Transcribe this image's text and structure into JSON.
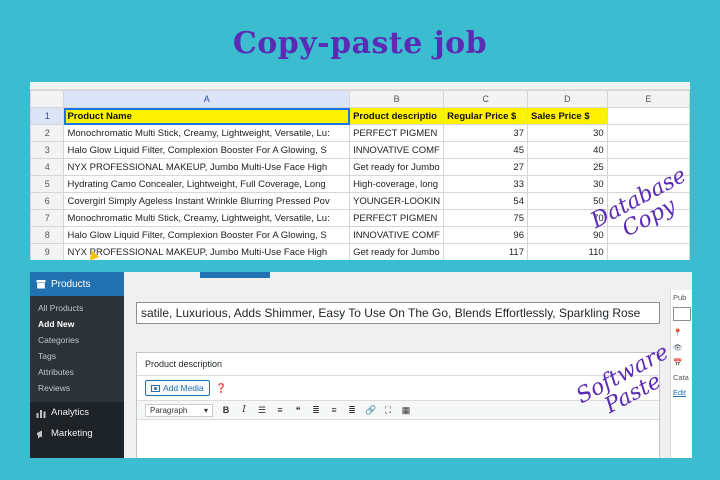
{
  "title": "Copy-paste job",
  "sheet": {
    "columns": [
      "A",
      "B",
      "C",
      "D",
      "E"
    ],
    "row_numbers": [
      "1",
      "2",
      "3",
      "4",
      "5",
      "6",
      "7",
      "8",
      "9"
    ],
    "headers": [
      "Product Name",
      "Product descriptio",
      "Regular Price $",
      "Sales Price $"
    ],
    "rows": [
      [
        "Monochromatic Multi Stick, Creamy, Lightweight, Versatile, Lu:",
        "PERFECT PIGMEN",
        "37",
        "30"
      ],
      [
        "Halo Glow Liquid Filter, Complexion Booster For A Glowing, S",
        "INNOVATIVE COMF",
        "45",
        "40"
      ],
      [
        "NYX PROFESSIONAL MAKEUP, Jumbo Multi-Use Face High",
        "Get ready for Jumbo",
        "27",
        "25"
      ],
      [
        "Hydrating Camo Concealer, Lightweight, Full Coverage, Long",
        "High-coverage, long",
        "33",
        "30"
      ],
      [
        "Covergirl Simply Ageless Instant Wrinkle Blurring Pressed Pov",
        "YOUNGER-LOOKIN",
        "54",
        "50"
      ],
      [
        "Monochromatic Multi Stick, Creamy, Lightweight, Versatile, Lu:",
        "PERFECT PIGMEN",
        "75",
        "70"
      ],
      [
        "Halo Glow Liquid Filter, Complexion Booster For A Glowing, S",
        "INNOVATIVE COMF",
        "96",
        "90"
      ],
      [
        "NYX PROFESSIONAL MAKEUP, Jumbo Multi-Use Face High",
        "Get ready for Jumbo",
        "117",
        "110"
      ]
    ]
  },
  "labels": {
    "database": [
      "Database",
      "Copy"
    ],
    "software": [
      "Software",
      "Paste"
    ]
  },
  "wp": {
    "menu_products": "Products",
    "submenu": [
      "All Products",
      "Add New",
      "Categories",
      "Tags",
      "Attributes",
      "Reviews"
    ],
    "current_submenu": "Add New",
    "menu_analytics": "Analytics",
    "menu_marketing": "Marketing",
    "title_value": "satile, Luxurious, Adds Shimmer, Easy To Use On The Go, Blends Effortlessly, Sparkling Rose",
    "desc_title": "Product description",
    "add_media": "Add Media",
    "format_select": "Paragraph",
    "right_panel": [
      "Pub",
      "Sa",
      "Cata",
      "Edit"
    ]
  },
  "colors": {
    "background": "#3bbccf",
    "title": "#5b2bb5",
    "header_fill": "#fff200",
    "wp_accent": "#2271b1"
  }
}
